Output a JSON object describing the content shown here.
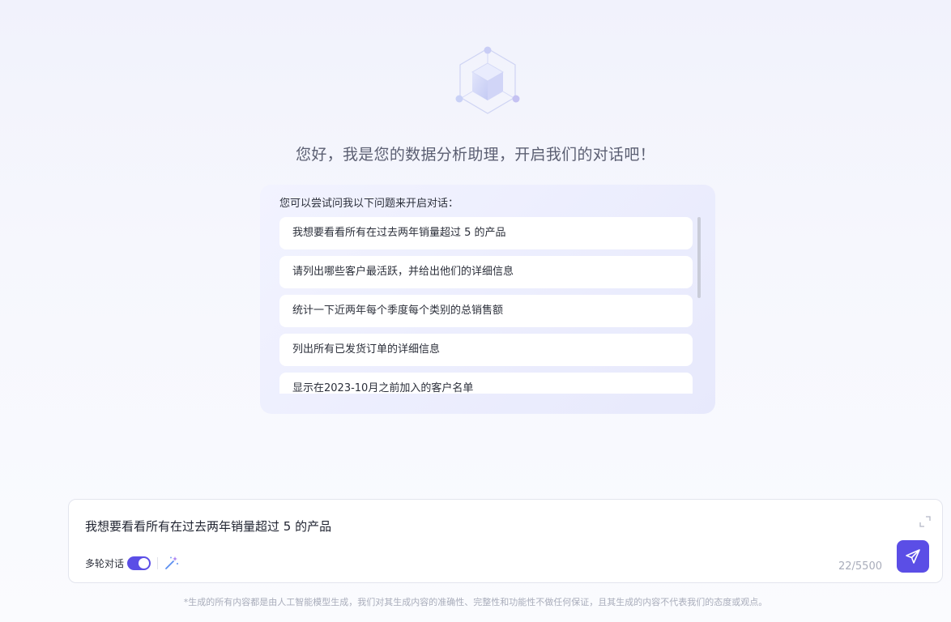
{
  "greeting": "您好，我是您的数据分析助理，开启我们的对话吧！",
  "suggestions": {
    "title": "您可以尝试问我以下问题来开启对话：",
    "items": [
      "我想要看看所有在过去两年销量超过 5 的产品",
      "请列出哪些客户最活跃，并给出他们的详细信息",
      "统计一下近两年每个季度每个类别的总销售额",
      "列出所有已发货订单的详细信息",
      "显示在2023-10月之前加入的客户名单"
    ]
  },
  "input": {
    "value": "我想要看看所有在过去两年销量超过 5 的产品",
    "multi_turn_label": "多轮对话",
    "multi_turn_enabled": true,
    "counter": "22/5500"
  },
  "icons": {
    "logo": "cube-network-logo",
    "expand": "expand-icon",
    "wand": "magic-wand-icon",
    "send": "paper-plane-icon"
  },
  "colors": {
    "accent": "#5b4ee6",
    "text": "#2b2f3a",
    "muted": "#a9adbb"
  },
  "disclaimer": "*生成的所有内容都是由人工智能模型生成，我们对其生成内容的准确性、完整性和功能性不做任何保证，且其生成的内容不代表我们的态度或观点。"
}
